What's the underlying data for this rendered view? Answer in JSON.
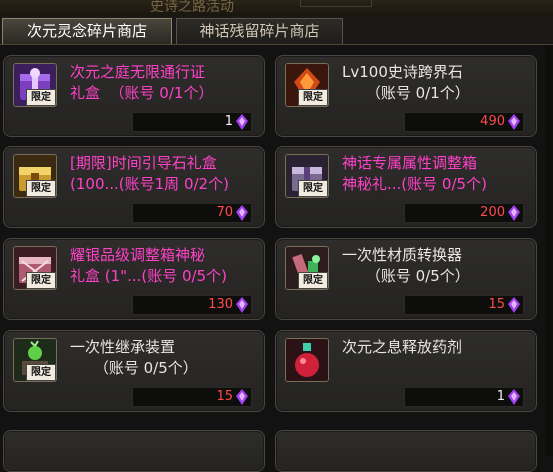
{
  "header": {
    "event_title": "史诗之路活动"
  },
  "tabs": [
    {
      "label": "次元灵念碎片商店",
      "active": true
    },
    {
      "label": "神话残留碎片商店",
      "active": false
    }
  ],
  "badge_label": "限定",
  "items": [
    {
      "name": "次元之庭无限通行证\n礼盒  （账号 0/1个）",
      "price": "1",
      "name_color": "pink",
      "price_color": "white",
      "limited": true,
      "icon": "purple-gift-box-icon"
    },
    {
      "name": "Lv100史诗跨界石\n     （账号 0/1个）",
      "price": "490",
      "name_color": "white",
      "price_color": "red",
      "limited": true,
      "icon": "orange-crystal-icon"
    },
    {
      "name": "[期限]时间引导石礼盒\n(100...(账号1周 0/2个)",
      "price": "70",
      "name_color": "pink",
      "price_color": "red",
      "limited": true,
      "icon": "gold-chest-icon"
    },
    {
      "name": "神话专属属性调整箱\n神秘礼...(账号 0/5个)",
      "price": "200",
      "name_color": "pink",
      "price_color": "red",
      "limited": true,
      "icon": "blue-box-icon"
    },
    {
      "name": "耀银品级调整箱神秘\n礼盒 (1\"...(账号 0/5个)",
      "price": "130",
      "name_color": "pink",
      "price_color": "red",
      "limited": true,
      "icon": "silver-box-icon"
    },
    {
      "name": "一次性材质转换器\n     （账号 0/5个）",
      "price": "15",
      "name_color": "white",
      "price_color": "red",
      "limited": true,
      "icon": "material-converter-icon"
    },
    {
      "name": "一次性继承装置\n     （账号 0/5个）",
      "price": "15",
      "name_color": "white",
      "price_color": "red",
      "limited": true,
      "icon": "inheritance-device-icon"
    },
    {
      "name": "次元之息释放药剂",
      "price": "1",
      "name_color": "white",
      "price_color": "white",
      "limited": false,
      "icon": "red-potion-icon"
    }
  ],
  "colors": {
    "pink_name": "#ff41c8",
    "red_price": "#ff4a4a",
    "badge_bg": "#f2ece0"
  }
}
